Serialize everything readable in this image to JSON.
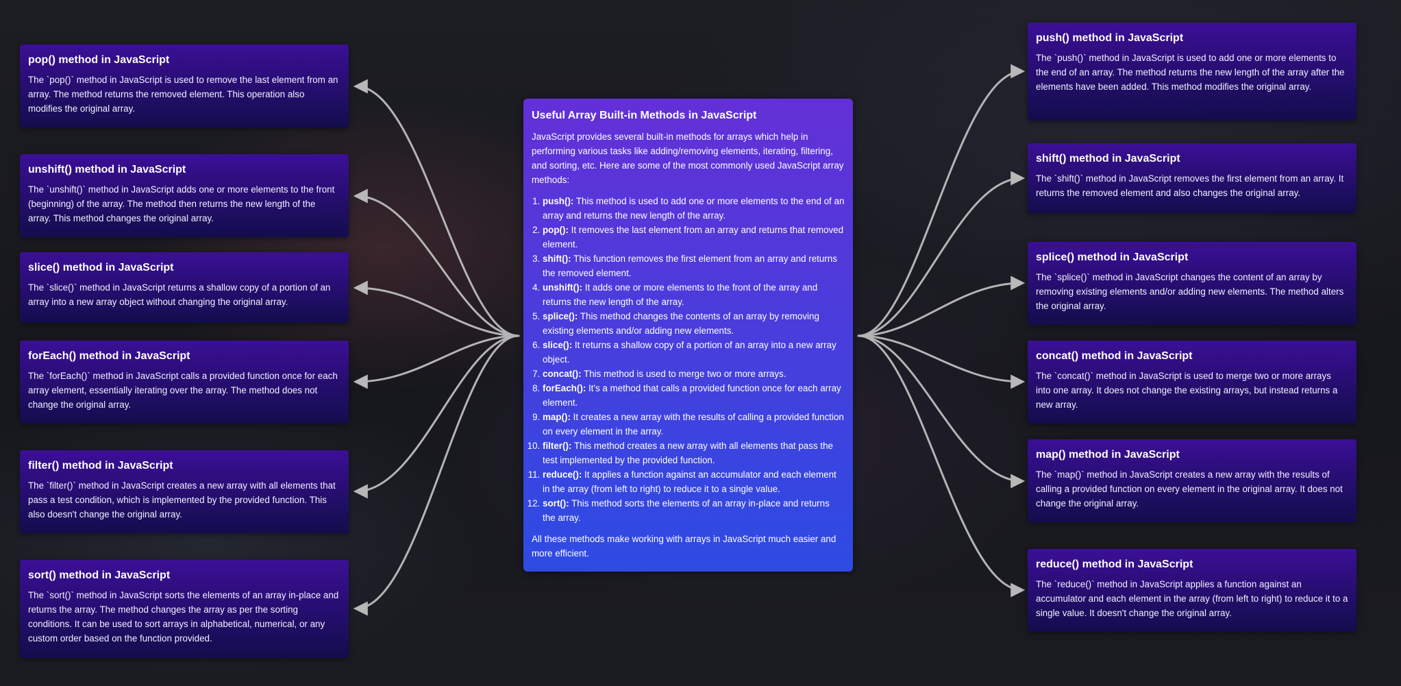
{
  "center": {
    "title": "Useful Array Built-in Methods in JavaScript",
    "intro": "JavaScript provides several built-in methods for arrays which help in performing various tasks like adding/removing elements, iterating, filtering, and sorting, etc. Here are some of the most commonly used JavaScript array methods:",
    "items": [
      {
        "name": "push():",
        "desc": " This method is used to add one or more elements to the end of an array and returns the new length of the array."
      },
      {
        "name": "pop():",
        "desc": " It removes the last element from an array and returns that removed element."
      },
      {
        "name": "shift():",
        "desc": " This function removes the first element from an array and returns the removed element."
      },
      {
        "name": "unshift():",
        "desc": " It adds one or more elements to the front of the array and returns the new length of the array."
      },
      {
        "name": "splice():",
        "desc": " This method changes the contents of an array by removing existing elements and/or adding new elements."
      },
      {
        "name": "slice():",
        "desc": " It returns a shallow copy of a portion of an array into a new array object."
      },
      {
        "name": "concat():",
        "desc": " This method is used to merge two or more arrays."
      },
      {
        "name": "forEach():",
        "desc": " It's a method that calls a provided function once for each array element."
      },
      {
        "name": "map():",
        "desc": " It creates a new array with the results of calling a provided function on every element in the array."
      },
      {
        "name": "filter():",
        "desc": " This method creates a new array with all elements that pass the test implemented by the provided function."
      },
      {
        "name": "reduce():",
        "desc": " It applies a function against an accumulator and each element in the array (from left to right) to reduce it to a single value."
      },
      {
        "name": "sort():",
        "desc": " This method sorts the elements of an array in-place and returns the array."
      }
    ],
    "outro": "All these methods make working with arrays in JavaScript much easier and more efficient."
  },
  "left_cards": [
    {
      "title": "pop() method in JavaScript",
      "body": "The `pop()` method in JavaScript is used to remove the last element from an array. The method returns the removed element. This operation also modifies the original array."
    },
    {
      "title": "unshift() method in JavaScript",
      "body": "The `unshift()` method in JavaScript adds one or more elements to the front (beginning) of the array. The method then returns the new length of the array. This method changes the original array."
    },
    {
      "title": "slice() method in JavaScript",
      "body": "The `slice()` method in JavaScript returns a shallow copy of a portion of an array into a new array object without changing the original array."
    },
    {
      "title": "forEach() method in JavaScript",
      "body": "The `forEach()` method in JavaScript calls a provided function once for each array element, essentially iterating over the array. The method does not change the original array."
    },
    {
      "title": "filter() method in JavaScript",
      "body": "The `filter()` method in JavaScript creates a new array with all elements that pass a test condition, which is implemented by the provided function. This also doesn't change the original array."
    },
    {
      "title": "sort() method in JavaScript",
      "body": "The `sort()` method in JavaScript sorts the elements of an array in-place and returns the array. The method changes the array as per the sorting conditions. It can be used to sort arrays in alphabetical, numerical, or any custom order based on the function provided."
    }
  ],
  "right_cards": [
    {
      "title": "push() method in JavaScript",
      "body": "The `push()` method in JavaScript is used to add one or more elements to the end of an array. The method returns the new length of the array after the elements have been added. This method modifies the original array."
    },
    {
      "title": "shift() method in JavaScript",
      "body": "The `shift()` method in JavaScript removes the first element from an array. It returns the removed element and also changes the original array."
    },
    {
      "title": "splice() method in JavaScript",
      "body": "The `splice()` method in JavaScript changes the content of an array by removing existing elements and/or adding new elements. The method alters the original array."
    },
    {
      "title": "concat() method in JavaScript",
      "body": "The `concat()` method in JavaScript is used to merge two or more arrays into one array. It does not change the existing arrays, but instead returns a new array."
    },
    {
      "title": "map() method in JavaScript",
      "body": "The `map()` method in JavaScript creates a new array with the results of calling a provided function on every element in the original array. It does not change the original array."
    },
    {
      "title": "reduce() method in JavaScript",
      "body": "The `reduce()` method in JavaScript applies a function against an accumulator and each element in the array (from left to right) to reduce it to a single value. It doesn't change the original array."
    }
  ]
}
